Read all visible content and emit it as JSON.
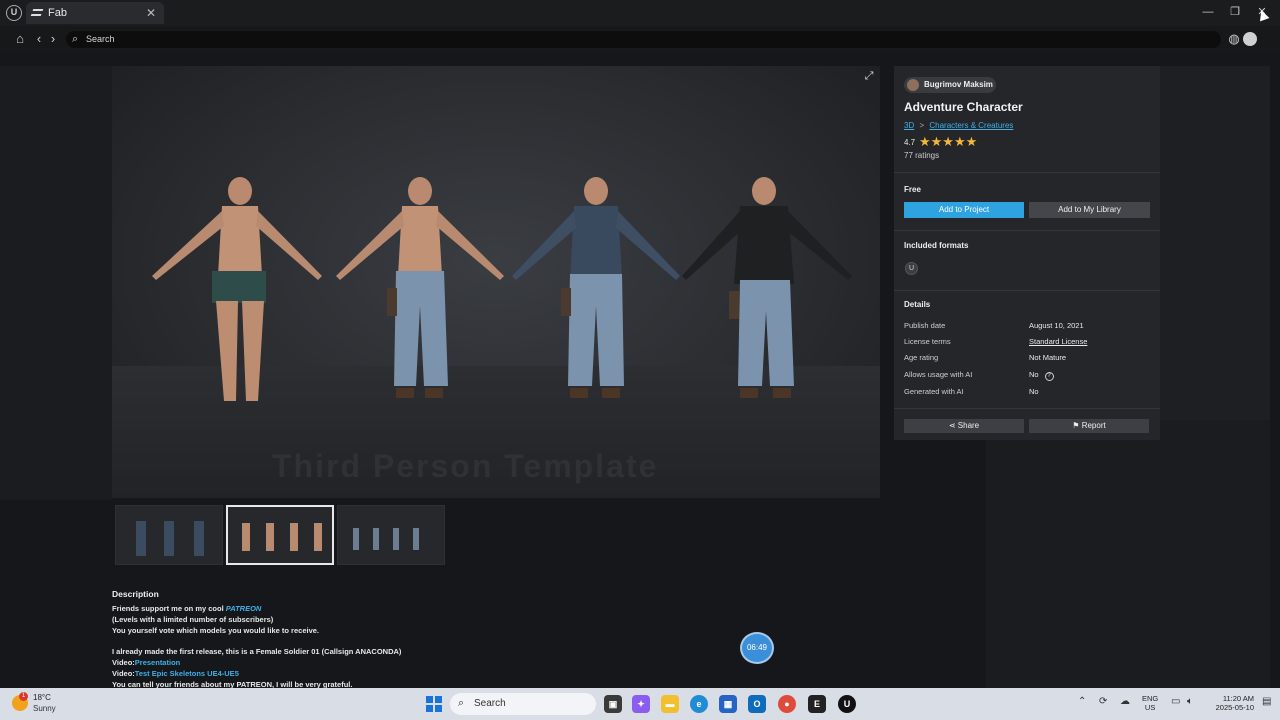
{
  "window": {
    "tab_title": "Fab",
    "tab_close": "✕",
    "controls": {
      "minimize": "—",
      "maximize": "❐",
      "close": "✕"
    }
  },
  "nav": {
    "search_placeholder": "Search"
  },
  "product": {
    "author": "Bugrimov Maksim",
    "title": "Adventure Character",
    "breadcrumb": {
      "category": "3D",
      "separator": ">",
      "subcategory": "Characters & Creatures"
    },
    "rating": "4.7",
    "stars": "★★★★★",
    "ratings_count": "77 ratings",
    "price": "Free",
    "add_to_project": "Add to Project",
    "add_to_library": "Add to My Library",
    "formats_title": "Included formats",
    "format_badge": "U",
    "details_title": "Details",
    "details": [
      {
        "label": "Publish date",
        "value": "August 10, 2021"
      },
      {
        "label": "License terms",
        "value": "Standard License"
      },
      {
        "label": "Age rating",
        "value": "Not Mature"
      },
      {
        "label": "Allows usage with AI",
        "value": "No"
      },
      {
        "label": "Generated with AI",
        "value": "No"
      }
    ],
    "share": "Share",
    "report": "Report",
    "hero_watermark": "Third Person Template"
  },
  "description": {
    "title": "Description",
    "line1_prefix": "Friends support me on my cool ",
    "line1_link": "PATREON",
    "line2": "(Levels with a limited number of subscribers)",
    "line3": "You yourself vote which models you would like to receive.",
    "line4": "I already made the first release, this is a Female Soldier 01 (Callsign ANACONDA)",
    "line5_prefix": "Video:",
    "line5_link": "Presentation",
    "line6_prefix": "Video:",
    "line6_link": "Test Epic Skeletons UE4-UE5",
    "line7": "You can tell your friends about my PATREON, I will be very grateful."
  },
  "overlay": {
    "timer": "06:49"
  },
  "taskbar": {
    "weather_temp": "18°C",
    "weather_cond": "Sunny",
    "weather_badge": "1",
    "search_placeholder": "Search",
    "lang_top": "ENG",
    "lang_bottom": "US",
    "time": "11:20 AM",
    "date": "2025-05-10"
  },
  "colors": {
    "accent": "#2fa3e0",
    "link": "#3fb0e8",
    "star": "#f2b63a"
  }
}
